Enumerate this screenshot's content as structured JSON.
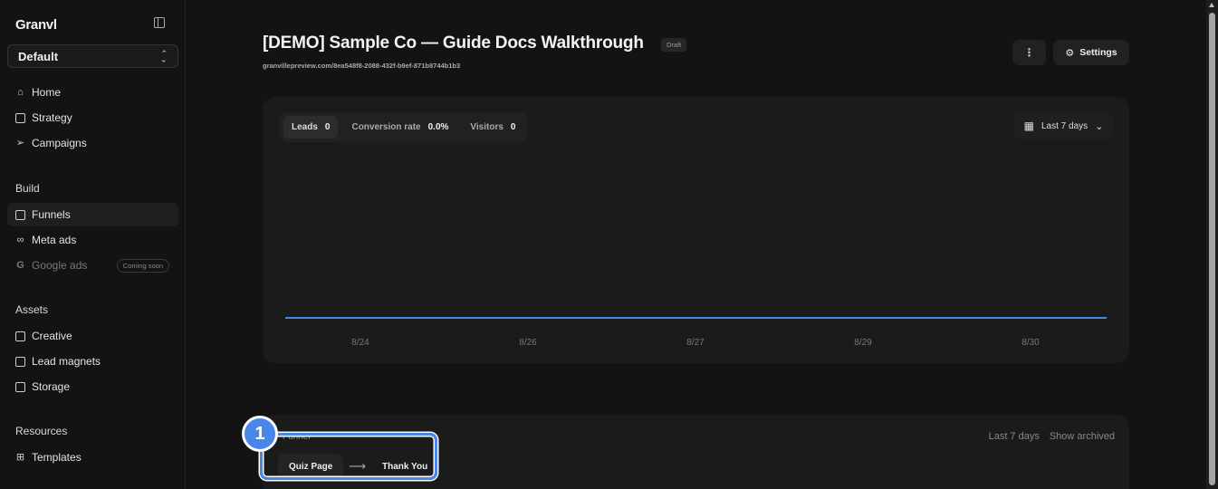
{
  "sidebar": {
    "brand": "Granvl",
    "workspace": "Default",
    "nav_primary": [
      {
        "label": "Home",
        "icon": "home-icon"
      },
      {
        "label": "Strategy",
        "icon": "book-icon"
      },
      {
        "label": "Campaigns",
        "icon": "send-icon"
      }
    ],
    "build_label": "Build",
    "nav_build": [
      {
        "label": "Funnels",
        "icon": "layout-icon"
      },
      {
        "label": "Meta ads",
        "icon": "meta-icon"
      },
      {
        "label": "Google ads",
        "icon": "google-icon",
        "badge": "Coming soon"
      }
    ],
    "assets_label": "Assets",
    "nav_assets": [
      {
        "label": "Creative",
        "icon": "monitor-icon"
      },
      {
        "label": "Lead magnets",
        "icon": "file-icon"
      },
      {
        "label": "Storage",
        "icon": "copy-icon"
      }
    ],
    "resources_label": "Resources",
    "nav_resources": [
      {
        "label": "Templates",
        "icon": "grid-icon"
      }
    ]
  },
  "header": {
    "title": "[DEMO] Sample Co — Guide Docs Walkthrough",
    "status": "Draft",
    "url": "granvillepreview.com/8ea548f8-2088-432f-b9ef-871b8744b1b3",
    "more_label": "⋮",
    "settings_label": "Settings"
  },
  "metrics": {
    "leads_label": "Leads",
    "leads_value": "0",
    "conv_label": "Conversion rate",
    "conv_value": "0.0%",
    "visitors_label": "Visitors",
    "visitors_value": "0"
  },
  "range_label": "Last 7 days",
  "chart_data": {
    "type": "line",
    "x": [
      "8/24",
      "8/26",
      "8/27",
      "8/29",
      "8/30"
    ],
    "series": [
      {
        "values": [
          0,
          0,
          0,
          0,
          0
        ]
      }
    ],
    "line_color": "#4a86e8"
  },
  "funnel": {
    "label": "Funnel",
    "range": "Last 7 days",
    "show_archived": "Show archived",
    "steps": [
      "Quiz Page",
      "Thank You"
    ],
    "arrow": "⟶"
  },
  "annotation": {
    "marker": "1",
    "color": "#4a86e8"
  }
}
